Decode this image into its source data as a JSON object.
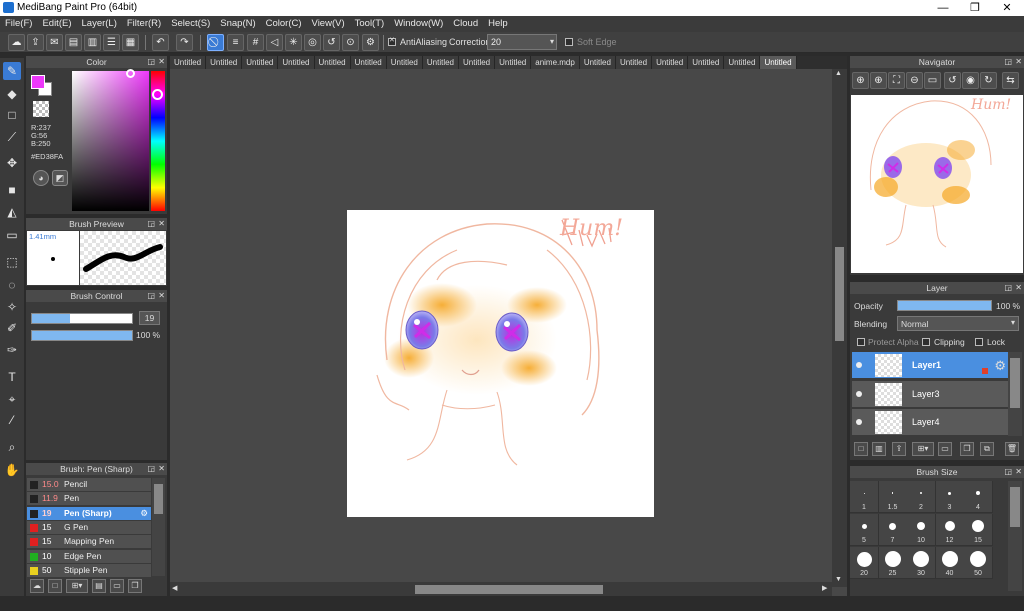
{
  "window": {
    "title": "MediBang Paint Pro (64bit)",
    "minimize": "—",
    "maximize": "❐",
    "close": "✕"
  },
  "menu": [
    "File(F)",
    "Edit(E)",
    "Layer(L)",
    "Filter(R)",
    "Select(S)",
    "Snap(N)",
    "Color(C)",
    "View(V)",
    "Tool(T)",
    "Window(W)",
    "Cloud",
    "Help"
  ],
  "toolbar": {
    "antialiasing_label": "AntiAliasing",
    "correction_label": "Correction",
    "correction_value": "20",
    "soft_edge_label": "Soft Edge"
  },
  "tabs": [
    "Untitled",
    "Untitled",
    "Untitled",
    "Untitled",
    "Untitled",
    "Untitled",
    "Untitled",
    "Untitled",
    "Untitled",
    "Untitled",
    "anime.mdp",
    "Untitled",
    "Untitled",
    "Untitled",
    "Untitled",
    "Untitled",
    "Untitled"
  ],
  "color_panel": {
    "title": "Color",
    "r": "R:237",
    "g": "G:56",
    "b": "B:250",
    "hex": "#ED38FA",
    "foreground": "#ED38FA"
  },
  "brush_preview": {
    "title": "Brush Preview",
    "size": "1.41mm"
  },
  "brush_control": {
    "title": "Brush Control",
    "size_value": "19",
    "size_fraction": 0.38,
    "opacity_value": "100 %",
    "opacity_fraction": 1.0
  },
  "brush_list": {
    "title": "Brush: Pen (Sharp)",
    "items": [
      {
        "size": "15.0",
        "name": "Pencil",
        "color": "#222222",
        "size_color": "#ff8a8a"
      },
      {
        "size": "11.9",
        "name": "Pen",
        "color": "#222222",
        "size_color": "#ff8a8a"
      },
      {
        "size": "19",
        "name": "Pen (Sharp)",
        "color": "#222222",
        "size_color": "#ff8a8a"
      },
      {
        "size": "15",
        "name": "G Pen",
        "color": "#e02020",
        "size_color": "#ffffff"
      },
      {
        "size": "15",
        "name": "Mapping Pen",
        "color": "#e02020",
        "size_color": "#ffffff"
      },
      {
        "size": "10",
        "name": "Edge Pen",
        "color": "#20b020",
        "size_color": "#ffffff"
      },
      {
        "size": "50",
        "name": "Stipple Pen",
        "color": "#e8d020",
        "size_color": "#ffffff"
      }
    ]
  },
  "canvas": {
    "doodle_text": "Hum!"
  },
  "navigator": {
    "title": "Navigator",
    "doodle_text": "Hum!"
  },
  "layer_panel": {
    "title": "Layer",
    "opacity_label": "Opacity",
    "opacity_value": "100 %",
    "opacity_fraction": 1.0,
    "blending_label": "Blending",
    "blending_value": "Normal",
    "protect_alpha_label": "Protect Alpha",
    "clipping_label": "Clipping",
    "lock_label": "Lock",
    "layers": [
      {
        "name": "Layer1",
        "selected": true
      },
      {
        "name": "Layer3",
        "selected": false
      },
      {
        "name": "Layer4",
        "selected": false
      }
    ]
  },
  "brush_size": {
    "title": "Brush Size",
    "sizes": [
      "1",
      "1.5",
      "2",
      "3",
      "4",
      "5",
      "7",
      "10",
      "12",
      "15",
      "20",
      "25",
      "30",
      "40",
      "50"
    ]
  }
}
